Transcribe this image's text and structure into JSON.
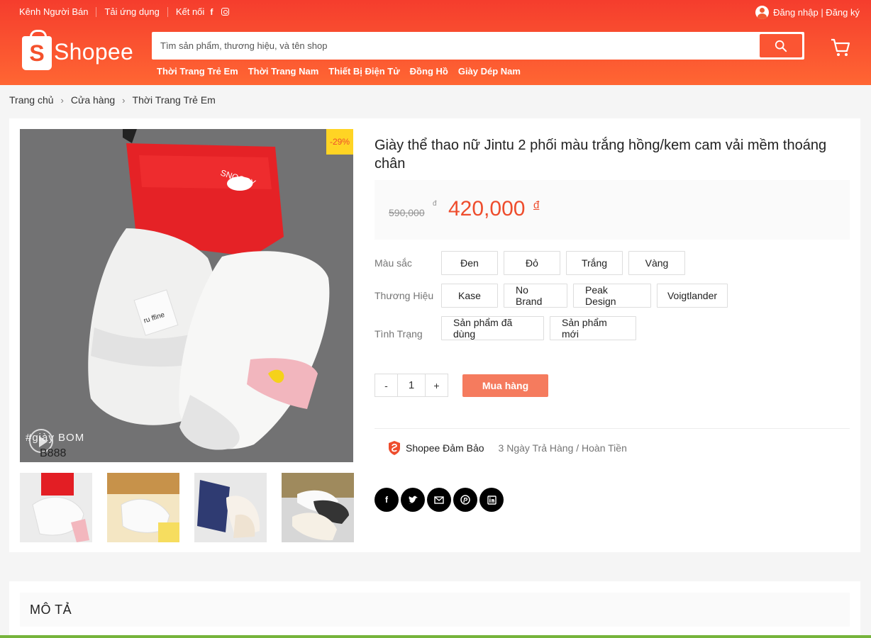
{
  "topbar": {
    "links": [
      "Kênh Người Bán",
      "Tải ứng dụng",
      "Kết nối"
    ],
    "social_icons": [
      "facebook-icon",
      "instagram-icon"
    ],
    "auth": "Đăng nhập | Đăng ký"
  },
  "header": {
    "logo_letter": "S",
    "logo_text": "Shopee",
    "search_placeholder": "Tìm sản phẩm, thương hiệu, và tên shop",
    "categories": [
      "Thời Trang Trẻ Em",
      "Thời Trang Nam",
      "Thiết Bị Điện Tử",
      "Đồng Hồ",
      "Giày Dép Nam"
    ],
    "brand_color": "#ee4d2d"
  },
  "breadcrumb": [
    "Trang chủ",
    "Cửa hàng",
    "Thời Trang Trẻ Em"
  ],
  "product": {
    "discount": "-29%",
    "watermark": "#giày BOM",
    "watermark_code": "B888",
    "title": "Giày thể thao nữ Jintu 2 phối màu trắng hồng/kem cam vải mềm thoáng chân",
    "old_price": "590,000",
    "old_currency": "đ",
    "price": "420,000",
    "currency": "đ",
    "options": [
      {
        "label": "Màu sắc",
        "values": [
          "Đen",
          "Đỏ",
          "Trắng",
          "Vàng"
        ]
      },
      {
        "label": "Thương Hiệu",
        "values": [
          "Kase",
          "No Brand",
          "Peak Design",
          "Voigtlander"
        ]
      },
      {
        "label": "Tình Trạng",
        "values": [
          "Sản phẩm đã dùng",
          "Sản phẩm mới"
        ]
      }
    ],
    "quantity": "1",
    "minus": "-",
    "plus": "+",
    "buy_label": "Mua hàng",
    "guarantee": "Shopee Đảm Bảo",
    "guarantee_sub": "3 Ngày Trả Hàng / Hoàn Tiền",
    "share_icons": [
      "facebook-icon",
      "twitter-icon",
      "email-icon",
      "pinterest-icon",
      "linkedin-icon"
    ]
  },
  "description": {
    "title": "MÔ TẢ"
  }
}
